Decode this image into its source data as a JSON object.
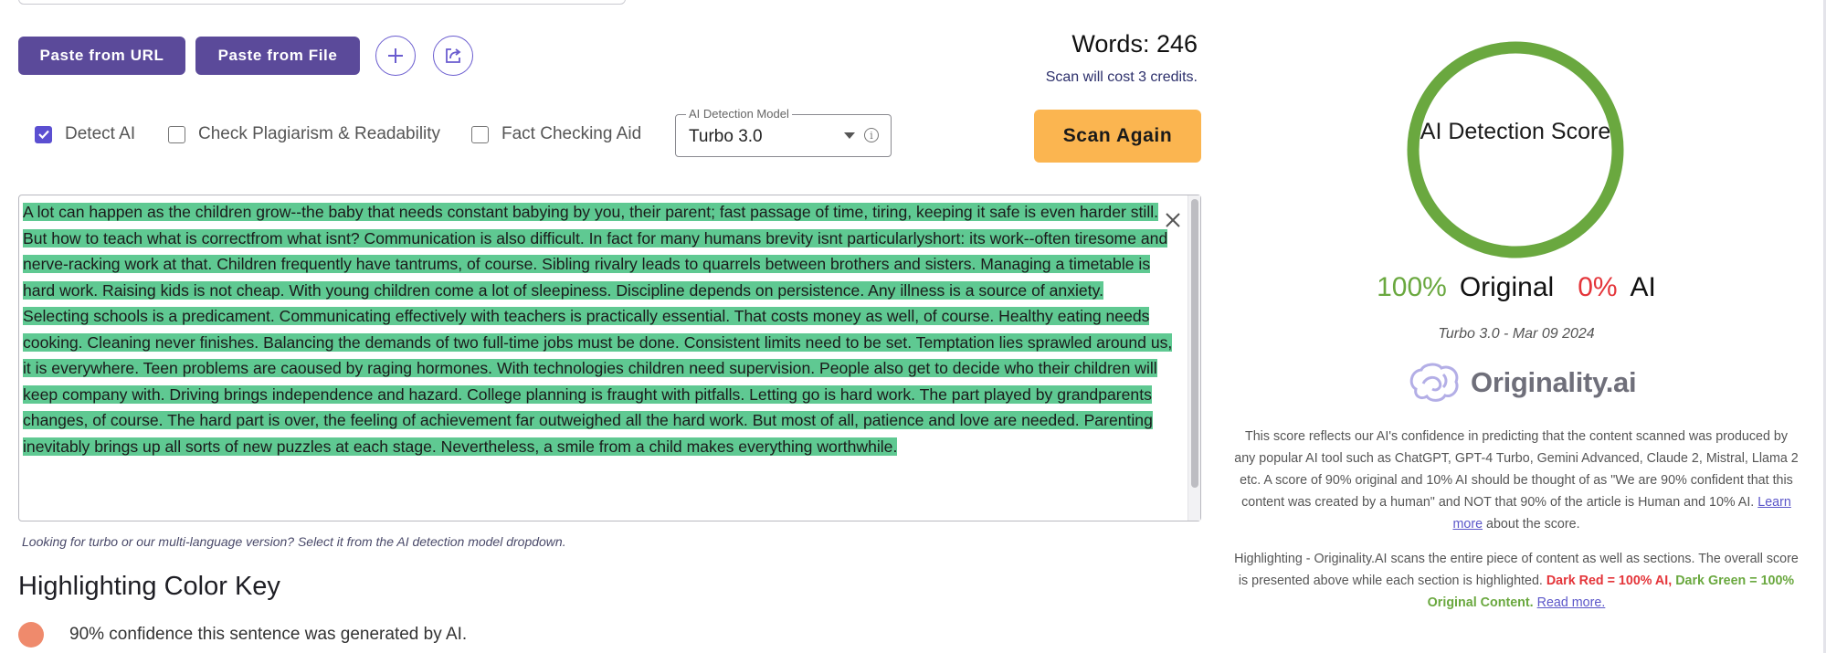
{
  "toolbar": {
    "paste_url_label": "Paste from URL",
    "paste_file_label": "Paste from File"
  },
  "stats": {
    "words": "Words: 246",
    "credits": "Scan will cost 3 credits."
  },
  "options": {
    "detect_ai": {
      "label": "Detect AI",
      "checked": true
    },
    "plagiarism": {
      "label": "Check Plagiarism & Readability",
      "checked": false
    },
    "fact_check": {
      "label": "Fact Checking Aid",
      "checked": false
    }
  },
  "model_select": {
    "legend": "AI Detection Model",
    "value": "Turbo 3.0"
  },
  "scan_button_label": "Scan Again",
  "editor": {
    "text": "A lot can happen as the children grow--the baby that needs constant babying by you, their parent; fast passage of time, tiring, keeping it safe is even harder still. But how to teach what is correctfrom what isnt? Communication is also difficult. In fact for many humans brevity isnt particularlyshort: its work--often tiresome and nerve-racking work at that. Children frequently have tantrums, of course. Sibling rivalry leads to quarrels between brothers and sisters. Managing a timetable is hard work. Raising kids is not cheap. With young children come a lot of sleepiness. Discipline depends on persistence. Any illness is a source of anxiety. Selecting schools is a predicament. Communicating effectively with teachers is practically essential. That costs money as well, of course. Healthy eating needs cooking. Cleaning never finishes. Balancing the demands of two full-time jobs must be done. Consistent limits need to be set. Temptation lies sprawled around us, it is everywhere. Teen problems are caoused by raging hormones. With technologies children need supervision. People also get to decide who their children will keep company with. Driving brings independence and hazard. College planning is fraught with pitfalls. Letting go is hard work. The part played by grandparents changes, of course. The hard part is over, the feeling of achievement far outweighed all the hard work. But most of all, patience and love are needed. Parenting inevitably brings up all sorts of new puzzles at each stage. Nevertheless, a smile from a child makes everything worthwhile.",
    "highlight_color": "#5fc992"
  },
  "hint": "Looking for turbo or our multi-language version? Select it from the AI detection model dropdown.",
  "color_key": {
    "title": "Highlighting Color Key",
    "items": [
      {
        "color": "#ef8a6c",
        "label": "90% confidence this sentence was generated by AI."
      }
    ]
  },
  "score": {
    "ring_label": "AI Detection Score",
    "original_pct": "100%",
    "original_label": "Original",
    "ai_pct": "0%",
    "ai_label": "AI",
    "original_fraction": 1.0,
    "ring_color": "#6aa83f",
    "model_date": "Turbo 3.0 - Mar 09 2024"
  },
  "brand": {
    "name": "Originality.ai",
    "icon": "brain-logo-icon"
  },
  "explanation": {
    "p1_text": "This score reflects our AI's confidence in predicting that the content scanned was produced by any popular AI tool such as ChatGPT, GPT-4 Turbo, Gemini Advanced, Claude 2, Mistral, Llama 2 etc. A score of 90% original and 10% AI should be thought of as \"We are 90% confident that this content was created by a human\" and NOT that 90% of the article is Human and 10% AI.",
    "p1_link": "Learn more",
    "p1_tail": "about the score.",
    "p2_text": "Highlighting - Originality.AI scans the entire piece of content as well as sections. The overall score is presented above while each section is highlighted.",
    "p2_red": "Dark Red = 100% AI,",
    "p2_green": "Dark Green = 100% Original Content.",
    "p2_link": "Read more."
  }
}
